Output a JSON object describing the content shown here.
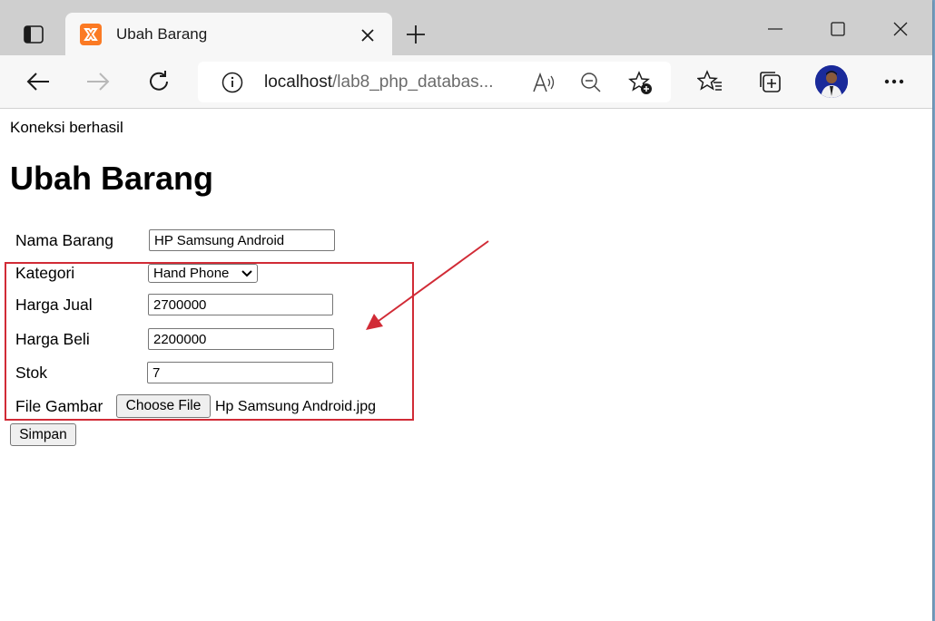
{
  "browser": {
    "tab_title": "Ubah Barang",
    "url_host": "localhost",
    "url_path": "/lab8_php_databas..."
  },
  "page": {
    "status_text": "Koneksi berhasil",
    "heading": "Ubah Barang",
    "form": {
      "nama_label": "Nama Barang",
      "nama_value": "HP Samsung Android",
      "kategori_label": "Kategori",
      "kategori_value": "Hand Phone",
      "harga_jual_label": "Harga Jual",
      "harga_jual_value": "2700000",
      "harga_beli_label": "Harga Beli",
      "harga_beli_value": "2200000",
      "stok_label": "Stok",
      "stok_value": "7",
      "file_label": "File Gambar",
      "file_button": "Choose File",
      "file_name": "Hp Samsung Android.jpg",
      "submit_label": "Simpan"
    }
  },
  "annotation": {
    "color": "#d12b36"
  },
  "colors": {
    "tabbar": "#cfcfcf",
    "toolbar": "#f7f7f7",
    "favicon": "#fb7a24"
  },
  "icons": [
    "tab-actions-icon",
    "xampp-favicon-icon",
    "close-icon",
    "plus-icon",
    "minimize-icon",
    "maximize-icon",
    "back-arrow-icon",
    "forward-arrow-icon",
    "refresh-icon",
    "info-icon",
    "read-aloud-icon",
    "zoom-out-icon",
    "add-favorite-icon",
    "favorites-icon",
    "collections-icon",
    "more-icon",
    "chevron-down-icon",
    "arrow-annotation"
  ]
}
